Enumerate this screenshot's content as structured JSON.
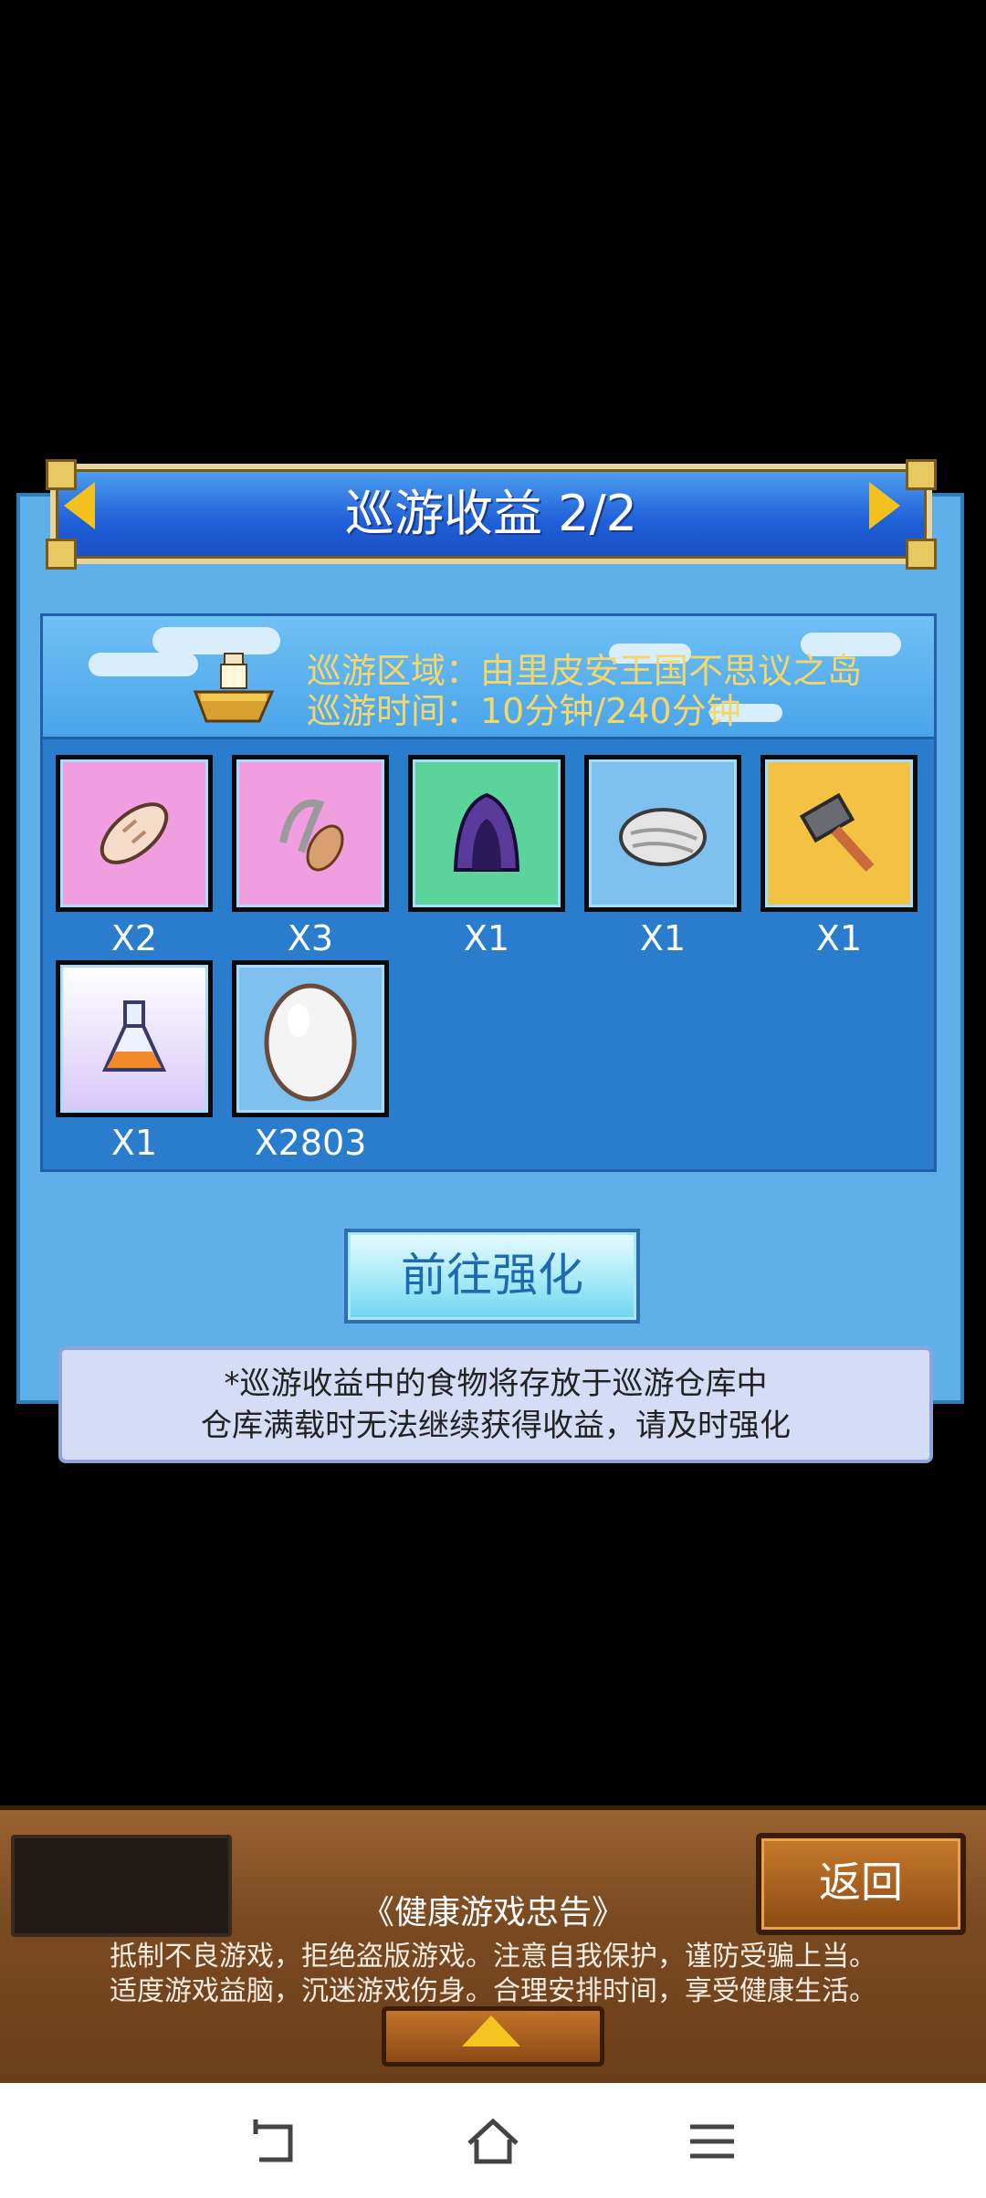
{
  "dialog": {
    "title": "巡游收益 2/2",
    "area_line": "巡游区域：由里皮安王国不思议之岛",
    "time_line": "巡游时间：10分钟/240分钟"
  },
  "items": [
    {
      "icon": "bread-icon",
      "qty": "X2"
    },
    {
      "icon": "wheat-icon",
      "qty": "X3"
    },
    {
      "icon": "purple-hood-icon",
      "qty": "X1"
    },
    {
      "icon": "stone-icon",
      "qty": "X1"
    },
    {
      "icon": "hammer-icon",
      "qty": "X1"
    },
    {
      "icon": "potion-flask-icon",
      "qty": "X1"
    },
    {
      "icon": "egg-icon",
      "qty": "X2803"
    }
  ],
  "enhance_label": "前往强化",
  "note": {
    "line1": "*巡游收益中的食物将存放于巡游仓库中",
    "line2": "仓库满载时无法继续获得收益，请及时强化"
  },
  "bottom": {
    "back_label": "返回",
    "notice_title": "《健康游戏忠告》",
    "notice_line1": "抵制不良游戏，拒绝盗版游戏。注意自我保护，谨防受骗上当。",
    "notice_line2": "适度游戏益脑，沉迷游戏伤身。合理安排时间，享受健康生活。"
  },
  "colors": {
    "panel": "#5fb0ea",
    "title_bar": "#1e5fd8",
    "info_text": "#f4d76a",
    "wood": "#7a4a22"
  }
}
